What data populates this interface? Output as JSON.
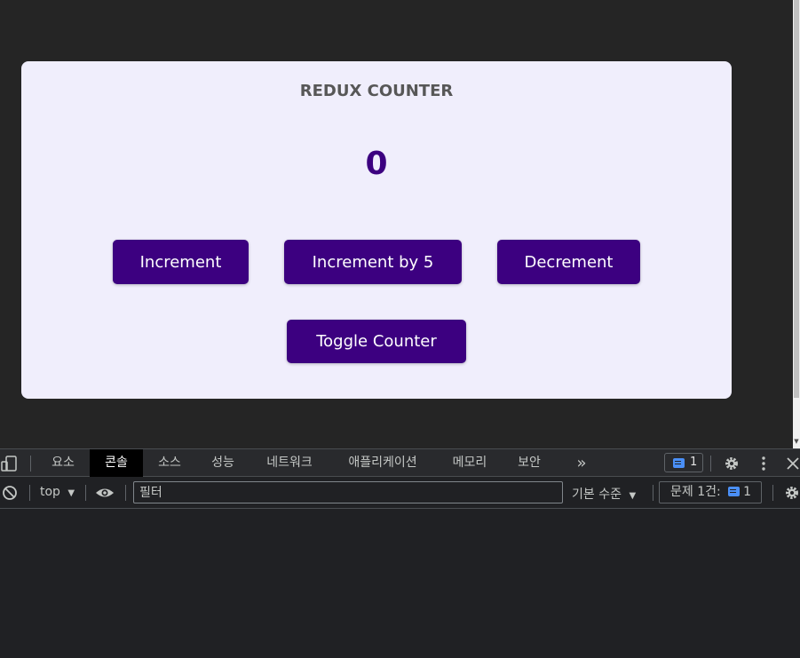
{
  "app": {
    "title": "REDUX COUNTER",
    "counter_value": "0",
    "buttons": {
      "increment": "Increment",
      "increment_by_5": "Increment by 5",
      "decrement": "Decrement",
      "toggle": "Toggle Counter"
    },
    "colors": {
      "card_bg": "#f0eefc",
      "accent": "#3c0080",
      "title": "#575757",
      "page_bg": "#252525"
    }
  },
  "devtools": {
    "tabs": [
      "요소",
      "콘솔",
      "소스",
      "성능",
      "네트워크",
      "애플리케이션",
      "메모리",
      "보안"
    ],
    "active_tab": "콘솔",
    "more_tabs_glyph": "»",
    "issue_count": "1",
    "icons": {
      "device_toggle": "device-toolbar-icon",
      "settings": "gear-icon",
      "menu": "kebab-menu-icon",
      "close": "close-icon",
      "clear": "clear-console-icon",
      "eye": "eye-icon",
      "issues": "message-icon"
    },
    "filter_bar": {
      "context": "top",
      "filter_placeholder": "필터",
      "level": "기본 수준",
      "issues_label": "문제 1건:",
      "issues_count": "1"
    }
  }
}
